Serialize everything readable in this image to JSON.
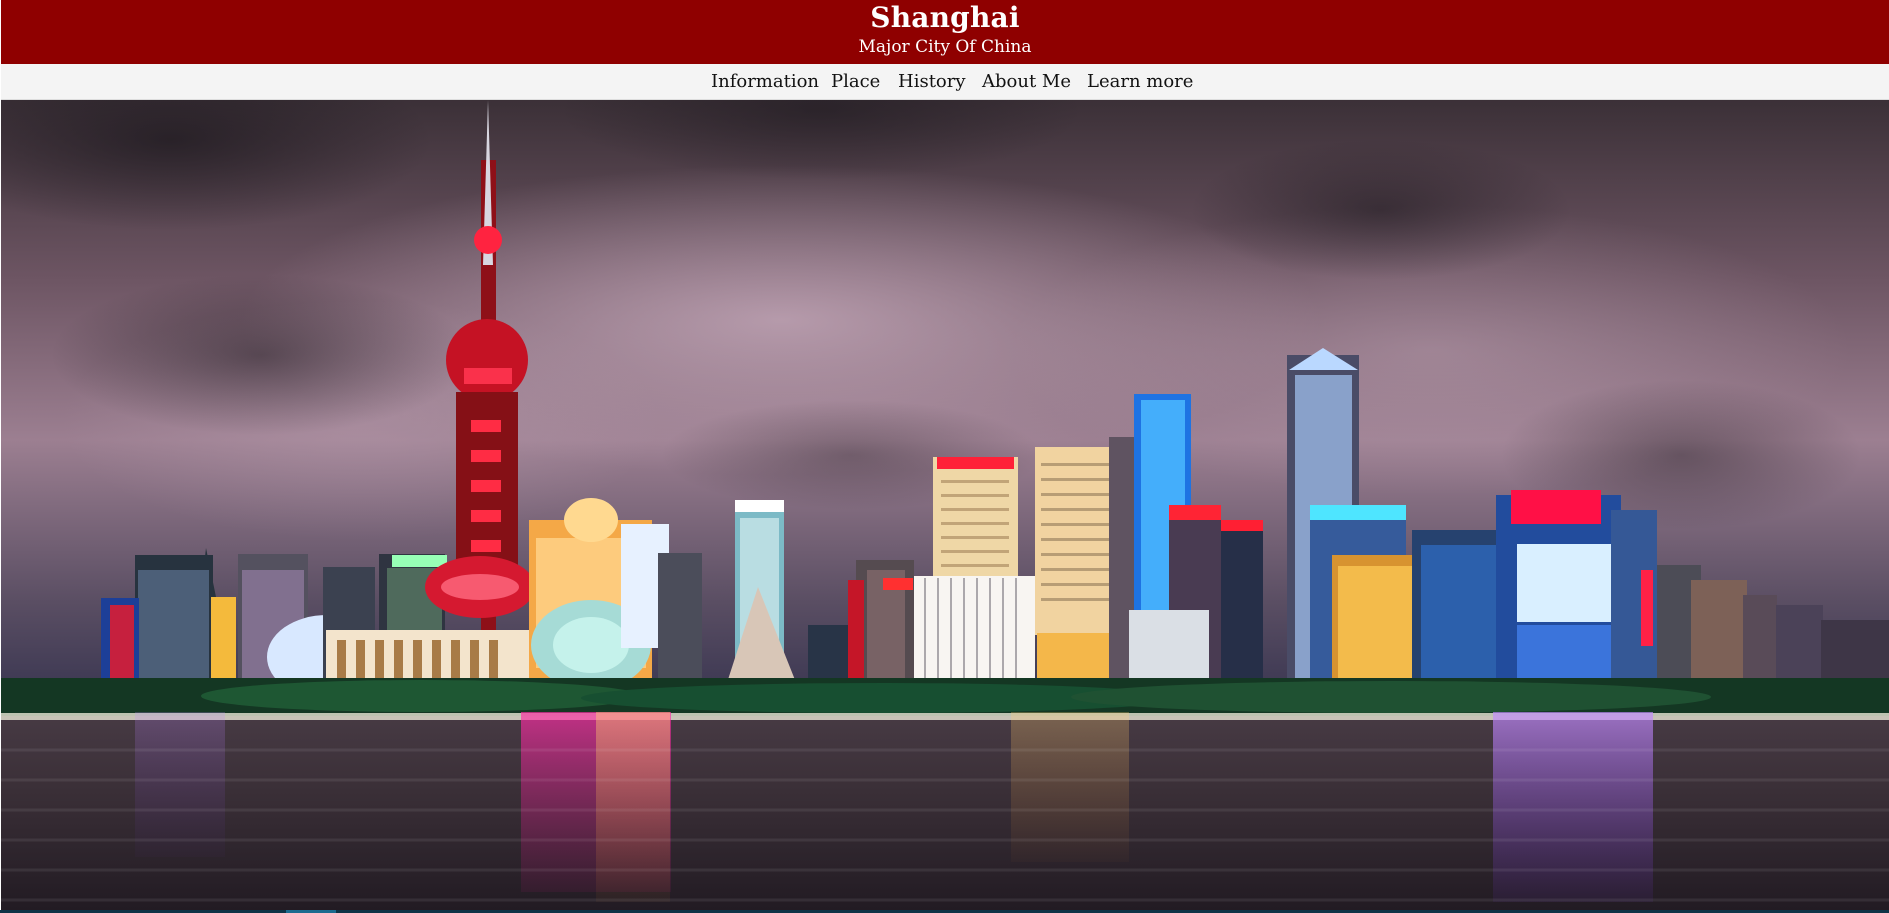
{
  "header": {
    "title": "Shanghai",
    "subtitle": "Major City Of China",
    "background_color": "#8f0000"
  },
  "nav": {
    "items": [
      {
        "label": "Information"
      },
      {
        "label": "Place"
      },
      {
        "label": "History"
      },
      {
        "label": "About Me"
      },
      {
        "label": "Learn more"
      }
    ]
  },
  "hero": {
    "icon": "city-skyline-image"
  }
}
